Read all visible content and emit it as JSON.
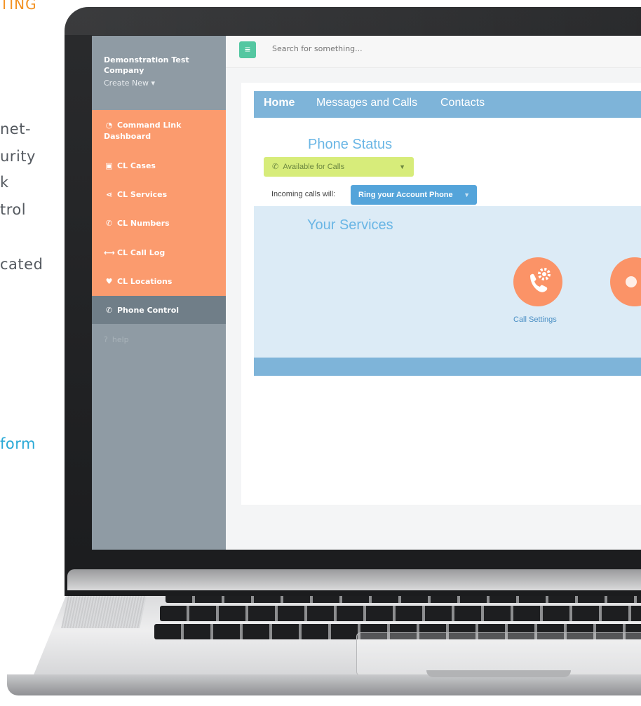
{
  "background_page": {
    "heading_fragment": "TING",
    "text_fragments": [
      "net-",
      "urity",
      "k",
      "trol",
      "cated"
    ],
    "link_fragment": "form"
  },
  "app": {
    "sidebar": {
      "company_name": "Demonstration Test Company",
      "create_new": "Create New",
      "items": [
        {
          "label": "Command Link Dashboard",
          "icon": "dashboard-icon"
        },
        {
          "label": "CL Cases",
          "icon": "briefcase-icon"
        },
        {
          "label": "CL Services",
          "icon": "share-icon"
        },
        {
          "label": "CL Numbers",
          "icon": "phone-icon"
        },
        {
          "label": "CL Call Log",
          "icon": "arrows-icon"
        },
        {
          "label": "CL Locations",
          "icon": "map-pin-icon"
        },
        {
          "label": "Phone Control",
          "icon": "phone-icon",
          "active": true
        },
        {
          "label": "help",
          "icon": "question-icon"
        }
      ],
      "colors": {
        "nav_bg": "#fb9b6e",
        "sidebar_bg": "#8f9ba4",
        "active_bg": "#707e88"
      }
    },
    "topbar": {
      "search_placeholder": "Search for something..."
    },
    "tabs": [
      "Home",
      "Messages and Calls",
      "Contacts"
    ],
    "phone_status": {
      "title": "Phone Status",
      "status_value": "Available for Calls",
      "incoming_label": "Incoming calls will:",
      "ring_value": "Ring your Account Phone"
    },
    "services": {
      "title": "Your Services",
      "items": [
        {
          "label": "Call Settings",
          "icon": "phone-gear-icon"
        }
      ]
    },
    "colors": {
      "accent_blue": "#7eb4d9",
      "status_green": "#d7ec7a",
      "ring_blue": "#54a4da",
      "service_orange": "#fb9367",
      "menu_green": "#54c7a1"
    }
  }
}
